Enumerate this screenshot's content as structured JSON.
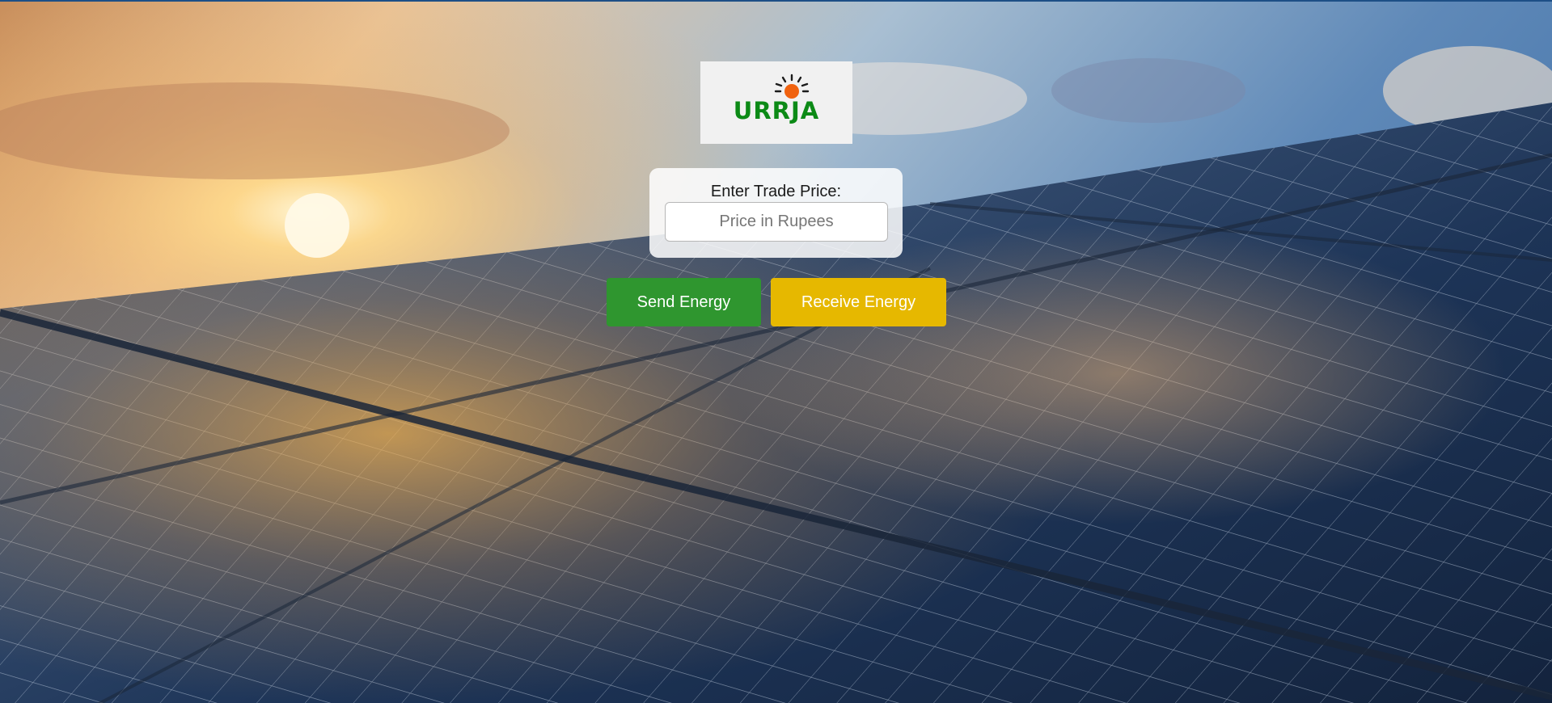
{
  "background": {
    "description_icon": "solar-panels-sunset-image"
  },
  "logo": {
    "text": "URRJA",
    "icon": "sun-icon",
    "text_color": "#0c8a16",
    "sun_color": "#f0620f"
  },
  "trade_form": {
    "label": "Enter Trade Price:",
    "input_value": "",
    "input_placeholder": "Price in Rupees"
  },
  "actions": {
    "send_label": "Send Energy",
    "send_color": "#2f962f",
    "receive_label": "Receive Energy",
    "receive_color": "#e6b800"
  }
}
